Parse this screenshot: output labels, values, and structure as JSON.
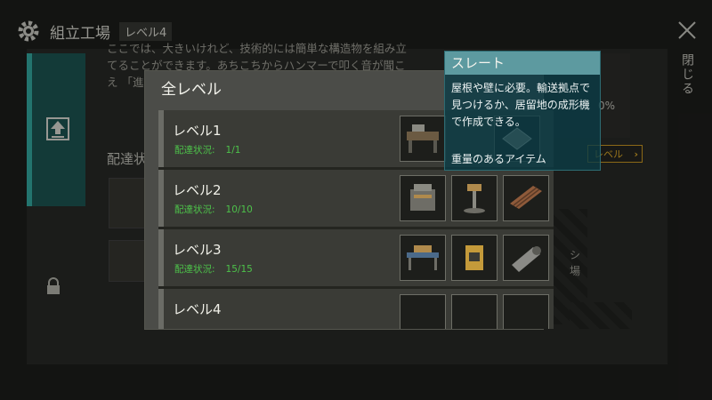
{
  "header": {
    "title": "組立工場",
    "level_tag": "レベル4",
    "close_label": "閉じる"
  },
  "background": {
    "description": "ここでは、大きいけれど、技術的には簡単な構造物を組み立てることができます。あちこちからハンマーで叩く音が聞こえ 「進行 ベルを しょう。",
    "subheading": "配達状",
    "right_pct": "0%",
    "level_button": "レベル",
    "side_text_1": "シ",
    "side_text_2": "場"
  },
  "modal": {
    "title": "全レベル",
    "status_label": "配達状況:",
    "rows": [
      {
        "name": "レベル1",
        "progress": "1/1",
        "icons": [
          "workbench-icon",
          "slate-icon"
        ]
      },
      {
        "name": "レベル2",
        "progress": "10/10",
        "icons": [
          "machine-icon",
          "drill-press-icon",
          "wooden-planks-icon"
        ]
      },
      {
        "name": "レベル3",
        "progress": "15/15",
        "icons": [
          "assembly-table-icon",
          "press-machine-icon",
          "pipe-icon"
        ]
      },
      {
        "name": "レベル4",
        "progress": "",
        "icons": [
          "workbench-icon",
          "machine-icon",
          "crate-icon"
        ]
      }
    ]
  },
  "tooltip": {
    "title": "スレート",
    "body": "屋根や壁に必要。輸送拠点で見つけるか、居留地の成形機で作成できる。",
    "weight": "重量のあるアイテム"
  },
  "colors": {
    "teal_accent": "#36b3a9",
    "status_green": "#4dc24a",
    "gold": "#d7a224",
    "tooltip_header": "#5d9aa0"
  }
}
